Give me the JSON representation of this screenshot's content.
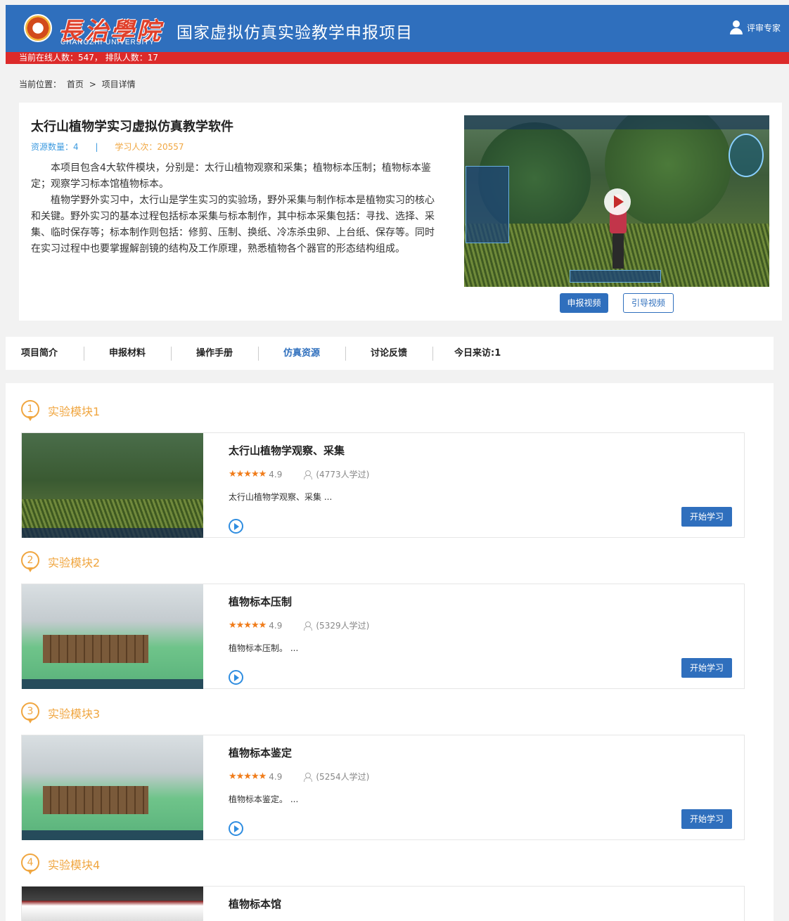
{
  "header": {
    "logo_cn": "長治學院",
    "logo_en": "CHANGZHI UNIVERSITY",
    "site_title": "国家虚拟仿真实验教学申报项目",
    "user_label": "评审专家"
  },
  "status_bar": {
    "text": "当前在线人数：547，   排队人数：17"
  },
  "breadcrumb": {
    "prefix": "当前位置：",
    "home": "首页",
    "separator": ">",
    "current": "项目详情"
  },
  "project": {
    "title": "太行山植物学实习虚拟仿真教学软件",
    "resource_count": "资源数量：4",
    "separator": "|",
    "learners": "学习人次：20557",
    "desc_p1": "本项目包含4大软件模块，分别是：太行山植物观察和采集；植物标本压制；植物标本鉴定；观察学习标本馆植物标本。",
    "desc_p2": "植物学野外实习中，太行山是学生实习的实验场，野外采集与制作标本是植物实习的核心和关键。野外实习的基本过程包括标本采集与标本制作，其中标本采集包括：寻找、选择、采集、临时保存等；标本制作则包括：修剪、压制、换纸、冷冻杀虫卵、上台纸、保存等。同时在实习过程中也要掌握解剖镜的结构及工作原理，熟悉植物各个器官的形态结构组成。",
    "btn_apply_video": "申报视频",
    "btn_guide_video": "引导视频"
  },
  "tabs": [
    {
      "label": "项目简介"
    },
    {
      "label": "申报材料"
    },
    {
      "label": "操作手册"
    },
    {
      "label": "仿真资源"
    },
    {
      "label": "讨论反馈"
    },
    {
      "label": "今日来访:1"
    }
  ],
  "modules": [
    {
      "num": "1",
      "label": "实验模块1",
      "title": "太行山植物学观察、采集",
      "score": "4.9",
      "learned": "(4773人学过)",
      "desc": "太行山植物学观察、采集 ...",
      "btn": "开始学习"
    },
    {
      "num": "2",
      "label": "实验模块2",
      "title": "植物标本压制",
      "score": "4.9",
      "learned": "(5329人学过)",
      "desc": "植物标本压制。 ...",
      "btn": "开始学习"
    },
    {
      "num": "3",
      "label": "实验模块3",
      "title": "植物标本鉴定",
      "score": "4.9",
      "learned": "(5254人学过)",
      "desc": "植物标本鉴定。 ...",
      "btn": "开始学习"
    },
    {
      "num": "4",
      "label": "实验模块4",
      "title": "植物标本馆"
    }
  ],
  "colors": {
    "header_blue": "#2f6fbd",
    "status_red": "#dc2a2a",
    "accent_orange": "#f0a640",
    "star_orange": "#f07c1a"
  },
  "icons": {
    "user": "user-icon",
    "play": "play-icon",
    "learner": "person-icon",
    "rating": "star-icon"
  }
}
